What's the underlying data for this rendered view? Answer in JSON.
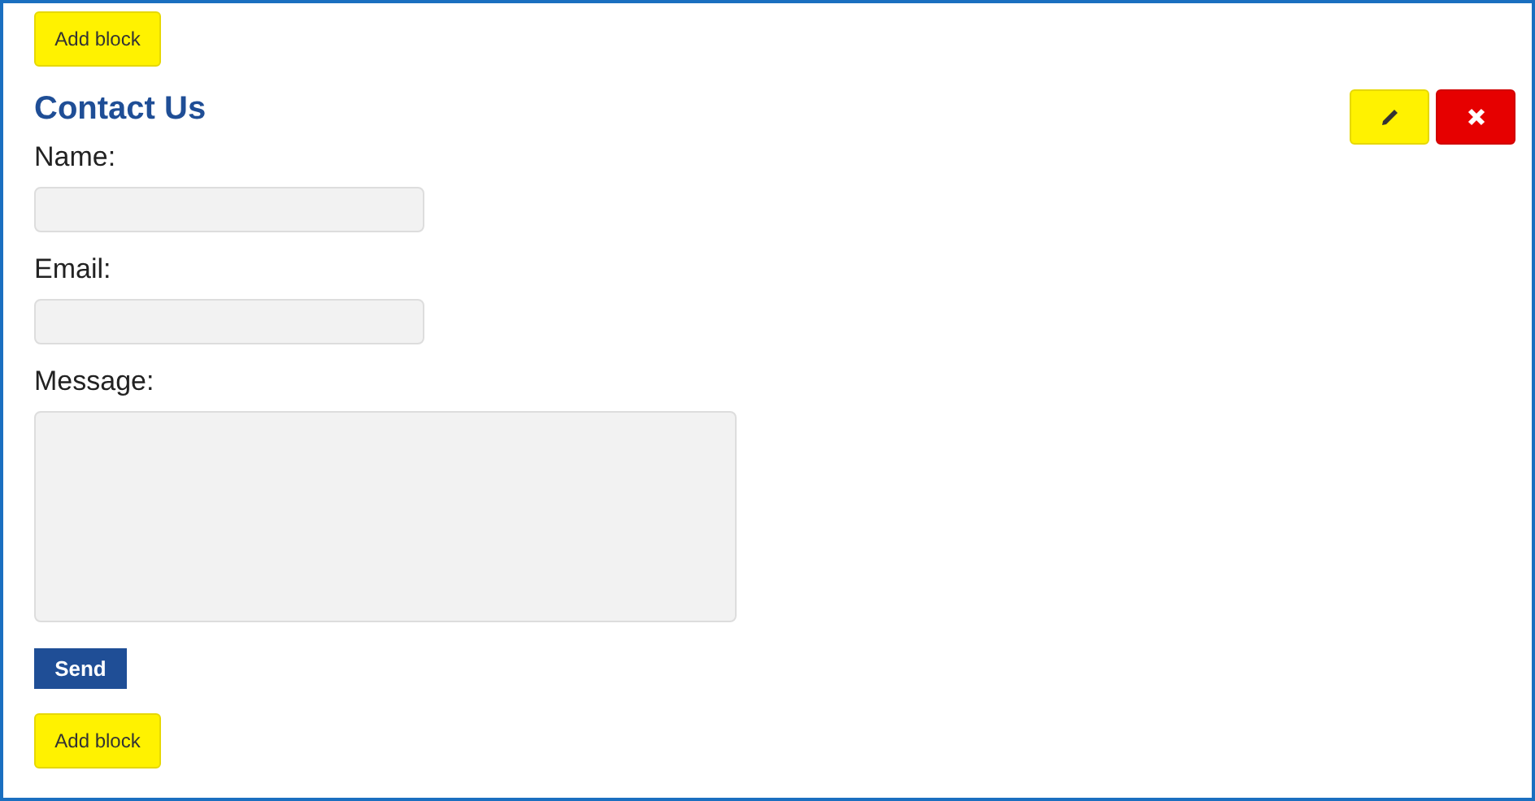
{
  "add_block_top": {
    "label": "Add block"
  },
  "block": {
    "title": "Contact Us",
    "fields": [
      {
        "kind": "text",
        "label": "Name:"
      },
      {
        "kind": "text",
        "label": "Email:"
      },
      {
        "kind": "textarea",
        "label": "Message:"
      }
    ],
    "submit": {
      "label": "Send"
    },
    "tools": [
      {
        "kind": "edit"
      },
      {
        "kind": "delete"
      }
    ]
  },
  "add_block_bottom": {
    "label": "Add block"
  }
}
